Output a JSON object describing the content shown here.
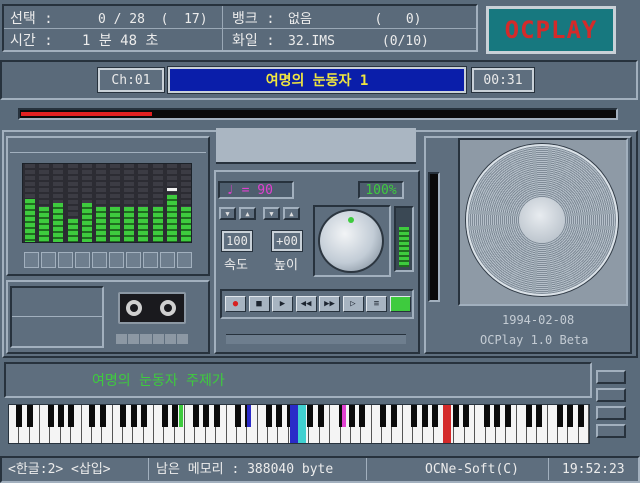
{
  "info": {
    "row1": {
      "label": "선택 :",
      "value": "0 / 28  (  17)"
    },
    "row2": {
      "label": "시간 :",
      "value": "1 분 48 초"
    },
    "bank": {
      "label": "뱅크 :",
      "value": "없음        (   0)"
    },
    "file": {
      "label": "화일 :",
      "value": "32.IMS      (0/10)"
    }
  },
  "logo": {
    "text": "OCPLAY",
    "color": "#d42a2a",
    "bg": "#17787f"
  },
  "title_bar": {
    "channel": "Ch:01",
    "song_title": "여명의 눈동자 1",
    "elapsed": "00:31",
    "title_bg": "#0a1eaa",
    "title_color": "#f0e640"
  },
  "progress": {
    "fraction": 0.22,
    "color": "#e02020"
  },
  "equalizer": {
    "levels": [
      0.55,
      0.45,
      0.5,
      0.3,
      0.5,
      0.45,
      0.45,
      0.45,
      0.45,
      0.45,
      0.6,
      0.45
    ],
    "peak_index": 10,
    "color": "#3ecb3e"
  },
  "tempo": {
    "text": "♩ = 90",
    "color": "#e040d0"
  },
  "volume": {
    "text": "100%",
    "color": "#3ecb3e"
  },
  "speed": {
    "value": "100",
    "label": "속도",
    "up_icon": "triangle-up-icon",
    "down_icon": "triangle-down-icon"
  },
  "pitch": {
    "value": "+00",
    "label": "높이"
  },
  "controls": [
    {
      "name": "record",
      "glyph": "●",
      "color": "#d82020"
    },
    {
      "name": "stop",
      "glyph": "■",
      "color": "#1d2530"
    },
    {
      "name": "play",
      "glyph": "▶",
      "color": "#1d2530"
    },
    {
      "name": "rewind",
      "glyph": "◀◀",
      "color": "#1d2530"
    },
    {
      "name": "fast-forward",
      "glyph": "▶▶",
      "color": "#1d2530"
    },
    {
      "name": "pause",
      "glyph": "▷",
      "color": "#1d2530"
    },
    {
      "name": "repeat",
      "glyph": "≡",
      "color": "#1d2530"
    },
    {
      "name": "next",
      "glyph": "",
      "color": "#3ecb3e"
    }
  ],
  "speaker_panel": {
    "date": "1994-02-08",
    "version": "OCPlay 1.0 Beta"
  },
  "lyrics": {
    "text": "여명의 눈동자 주제가",
    "color": "#3ecb3e"
  },
  "status": {
    "mode": "<한글:2> <삽입>",
    "memory": "남은 메모리 : 388040 byte",
    "company": "OCNe-Soft(C)",
    "clock": "19:52:23"
  }
}
